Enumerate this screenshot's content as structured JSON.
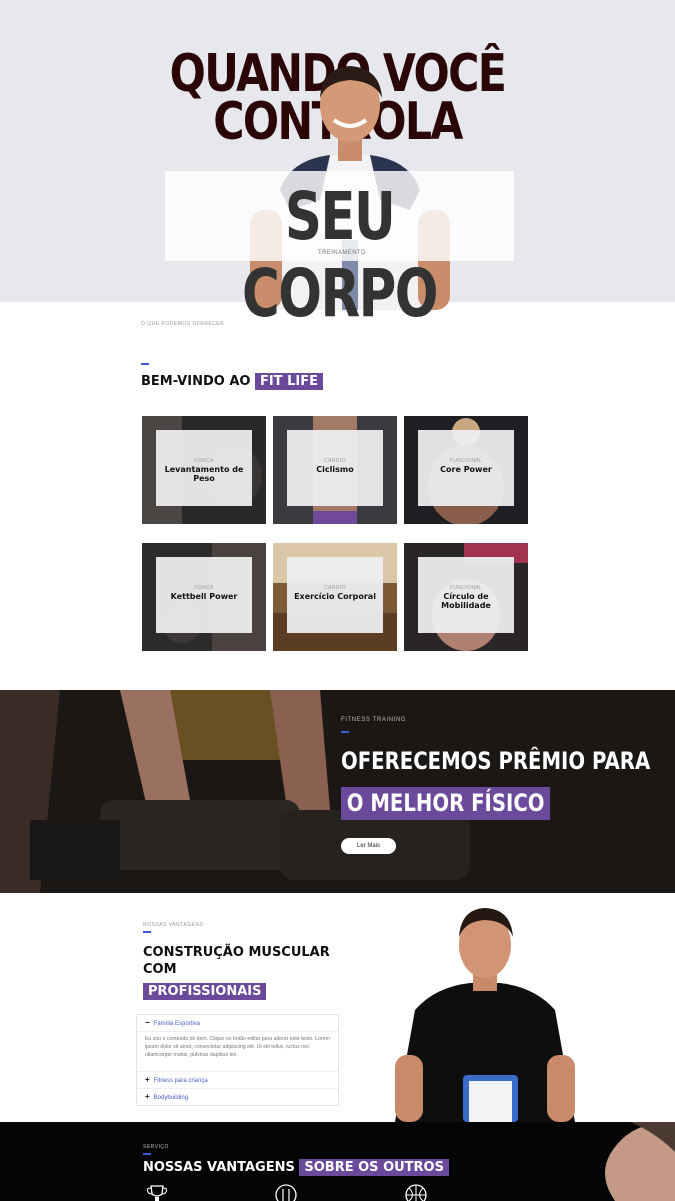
{
  "hero": {
    "line1": "QUANDO VOCÊ",
    "line2": "CONTROLA",
    "big": "SEU CORPO",
    "small": "TREINAMENTO"
  },
  "offers": {
    "eyebrow": "O QUE PODEMOS OFERECER",
    "title": "BEM-VINDO AO",
    "highlight": "FIT LIFE",
    "cards": [
      {
        "category": "FORÇA",
        "title": "Levantamento de Peso"
      },
      {
        "category": "CARDIO",
        "title": "Ciclismo"
      },
      {
        "category": "FUNCIONAL",
        "title": "Core Power"
      },
      {
        "category": "FORÇA",
        "title": "Kettbell Power"
      },
      {
        "category": "CARDIO",
        "title": "Exercício Corporal"
      },
      {
        "category": "FUNCIONAL",
        "title": "Círculo de Mobilidade"
      }
    ]
  },
  "banner": {
    "eyebrow": "FITNESS TRAINING",
    "title": "OFERECEMOS PRÊMIO PARA",
    "highlight": "O MELHOR FÍSICO",
    "button": "Ler Mais"
  },
  "advantages": {
    "eyebrow": "NOSSAS VANTAGENS",
    "title_line1": "CONSTRUÇÃO MUSCULAR",
    "title_line2": "COM",
    "highlight": "PROFISSIONAIS",
    "accordion": [
      {
        "label": "Família Esportiva",
        "open": true,
        "body": "Eu sou o conteúdo do item. Clique no botão editar para alterar este texto. Lorem ipsum dolor sit amet, consectetur adipiscing elit. Ut elit tellus, luctus nec ullamcorper mattis, pulvinar dapibus leo."
      },
      {
        "label": "Fitness para criança",
        "open": false
      },
      {
        "label": "Bodybuilding",
        "open": false
      }
    ]
  },
  "services": {
    "eyebrow": "SERVIÇO",
    "title": "NOSSAS VANTAGENS",
    "highlight": "SOBRE OS OUTROS"
  },
  "colors": {
    "accent": "#6b4a9b",
    "hero_bg": "#e7e8ee",
    "hero_text": "#2a0606",
    "link": "#4a60c8"
  }
}
